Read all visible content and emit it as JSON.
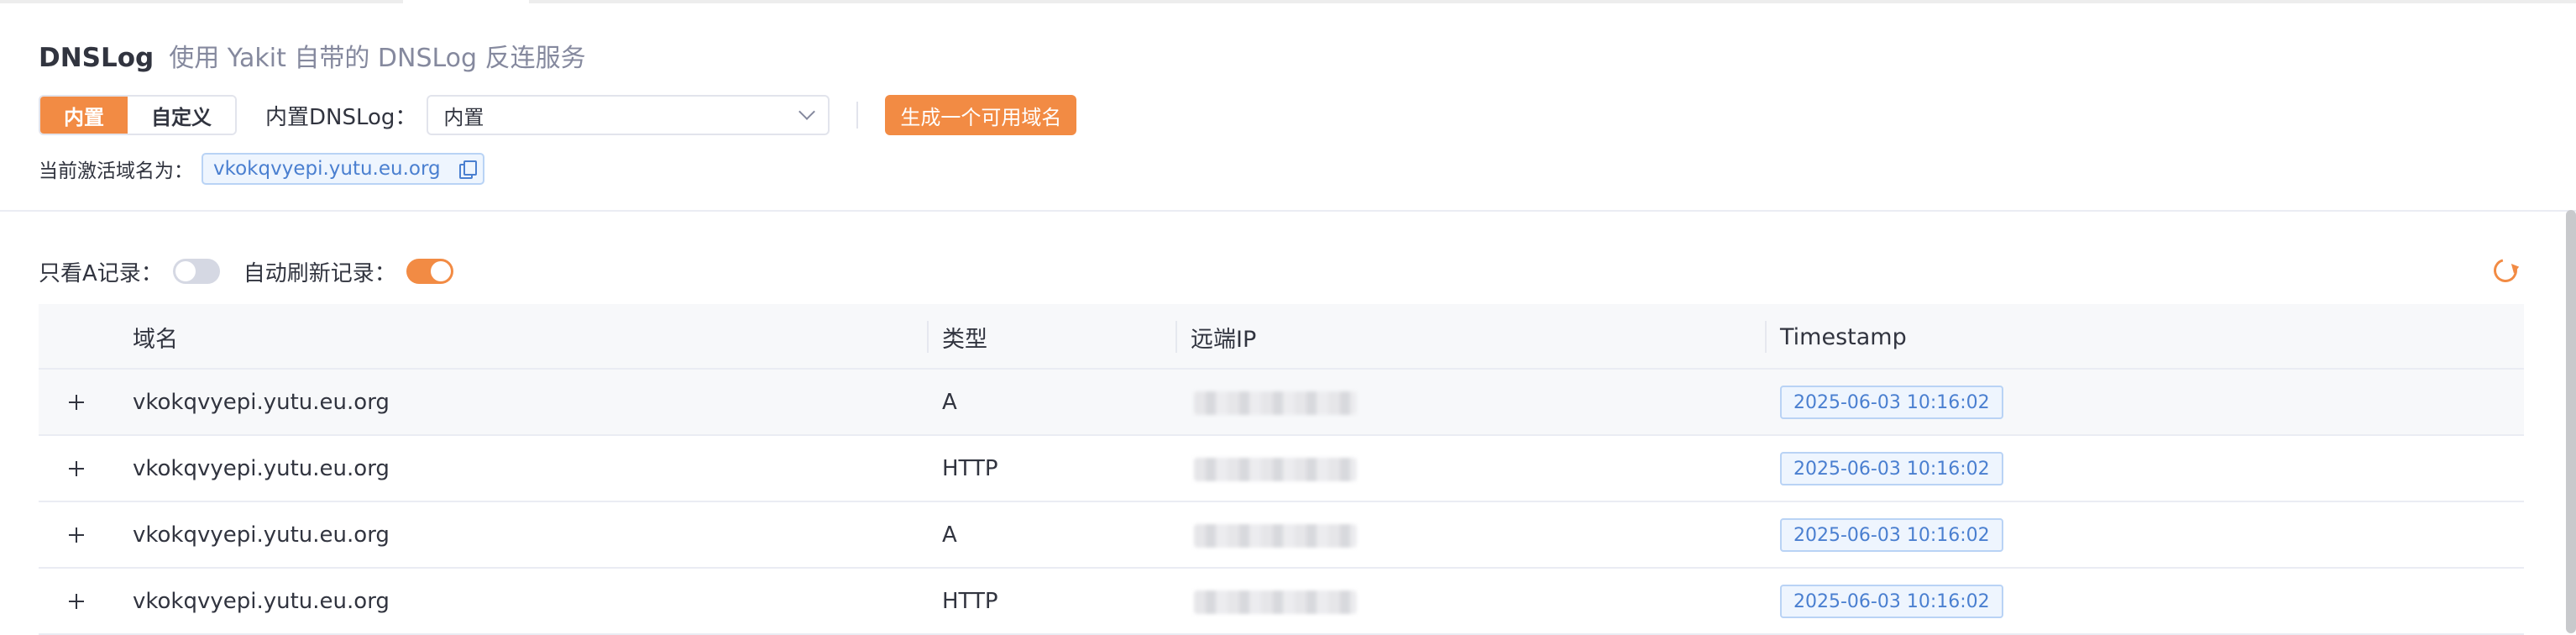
{
  "header": {
    "title": "DNSLog",
    "subtitle": "使用 Yakit 自带的 DNSLog 反连服务",
    "mode_tabs": [
      {
        "label": "内置",
        "active": true
      },
      {
        "label": "自定义",
        "active": false
      }
    ],
    "dns_label": "内置DNSLog：",
    "dns_select_value": "内置",
    "generate_button": "生成一个可用域名",
    "active_domain_label": "当前激活域名为：",
    "active_domain": "vkokqvyepi.yutu.eu.org"
  },
  "filters": {
    "only_a_label": "只看A记录：",
    "only_a_enabled": false,
    "auto_refresh_label": "自动刷新记录：",
    "auto_refresh_enabled": true
  },
  "table": {
    "columns": [
      "域名",
      "类型",
      "远端IP",
      "Timestamp"
    ],
    "rows": [
      {
        "domain": "vkokqvyepi.yutu.eu.org",
        "type": "A",
        "remote_ip": "",
        "timestamp": "2025-06-03 10:16:02"
      },
      {
        "domain": "vkokqvyepi.yutu.eu.org",
        "type": "HTTP",
        "remote_ip": "",
        "timestamp": "2025-06-03 10:16:02"
      },
      {
        "domain": "vkokqvyepi.yutu.eu.org",
        "type": "A",
        "remote_ip": "",
        "timestamp": "2025-06-03 10:16:02"
      },
      {
        "domain": "vkokqvyepi.yutu.eu.org",
        "type": "HTTP",
        "remote_ip": "",
        "timestamp": "2025-06-03 10:16:02"
      }
    ]
  },
  "colors": {
    "accent": "#f28b44",
    "tag_blue": "#4a7fd0",
    "tag_bg": "#eef5fe"
  },
  "icons": [
    "copy-icon",
    "refresh-icon",
    "expand-plus-icon",
    "chevron-down-icon"
  ]
}
